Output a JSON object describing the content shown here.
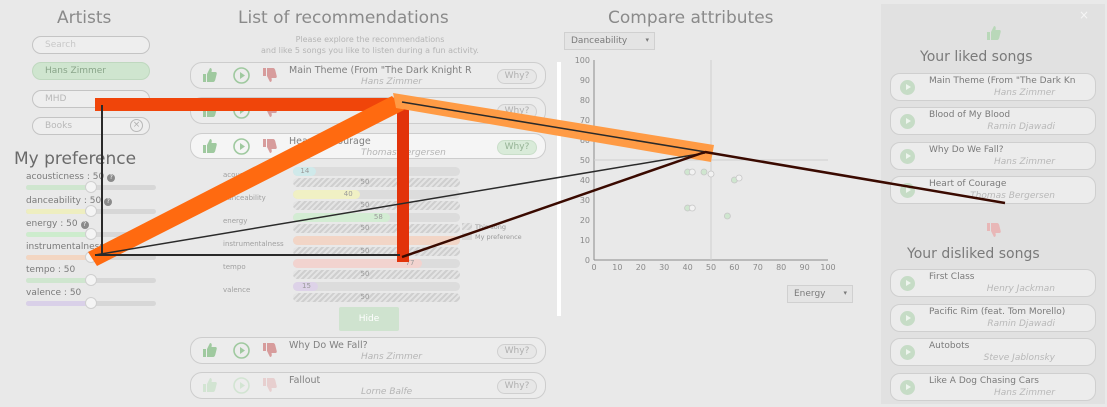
{
  "artists": {
    "title": "Artists",
    "search_placeholder": "Search",
    "selected": [
      "Hans Zimmer",
      "MHD",
      "Books"
    ]
  },
  "preference": {
    "title": "My preference",
    "sliders": [
      {
        "label": "acousticness : 50",
        "value": 50,
        "color": "#cfe6cf"
      },
      {
        "label": "danceability : 50",
        "value": 50,
        "color": "#eeeec0"
      },
      {
        "label": "energy : 50",
        "value": 50,
        "color": "#cdeccd"
      },
      {
        "label": "instrumentalness",
        "value": 50,
        "color": "#f3d6c2"
      },
      {
        "label": "tempo : 50",
        "value": 50,
        "color": "#cfe6cf"
      },
      {
        "label": "valence : 50",
        "value": 50,
        "color": "#d9d0e8"
      }
    ]
  },
  "recommendations": {
    "title": "List of recommendations",
    "subtitle_line1": "Please explore the recommendations",
    "subtitle_line2": "and like 5 songs you like to listen during a fun activity.",
    "why_label": "Why?",
    "hide_label": "Hide",
    "songs": [
      {
        "title": "Main Theme (From \"The Dark Knight R",
        "artist": "Hans Zimmer"
      },
      {
        "title": "",
        "artist": ""
      },
      {
        "title": "Heart of Courage",
        "artist": "Thomas Bergersen"
      },
      {
        "title": "Why Do We Fall?",
        "artist": "Hans Zimmer"
      },
      {
        "title": "Fallout",
        "artist": "Lorne Balfe"
      }
    ],
    "detail": {
      "attributes": [
        {
          "label": "acousticness",
          "song": 14,
          "pref": 50,
          "color": "#cfe9ea"
        },
        {
          "label": "danceability",
          "song": 40,
          "pref": 50,
          "color": "#f0f0c4"
        },
        {
          "label": "energy",
          "song": 58,
          "pref": 50,
          "color": "#d3ecd3"
        },
        {
          "label": "instrumentalness",
          "song": 100,
          "pref": 50,
          "color": "#f2d5c6"
        },
        {
          "label": "tempo",
          "song": 77,
          "pref": 50,
          "color": "#f2d3cf"
        },
        {
          "label": "valence",
          "song": 15,
          "pref": 50,
          "color": "#ddd2e8"
        }
      ],
      "song_values": [
        "14",
        "40",
        "58",
        "",
        "77",
        "15"
      ],
      "pref_value": "50",
      "legend_song": "This song",
      "legend_pref": "My preference"
    }
  },
  "compare": {
    "title": "Compare attributes",
    "y_dropdown": "Danceability",
    "x_dropdown": "Energy"
  },
  "chart_data": {
    "type": "scatter",
    "title": "",
    "xlabel": "",
    "ylabel": "",
    "xlim": [
      0,
      100
    ],
    "ylim": [
      0,
      100
    ],
    "x_ticks": [
      "0",
      "10",
      "20",
      "30",
      "40",
      "50",
      "60",
      "70",
      "80",
      "90",
      "100"
    ],
    "y_ticks": [
      "0",
      "10",
      "20",
      "30",
      "40",
      "50",
      "60",
      "70",
      "80",
      "90",
      "100"
    ],
    "grid": false,
    "crosshair": {
      "x": 50,
      "y": 50
    },
    "points": [
      {
        "x": 40,
        "y": 44
      },
      {
        "x": 42,
        "y": 44
      },
      {
        "x": 47,
        "y": 44
      },
      {
        "x": 50,
        "y": 43
      },
      {
        "x": 60,
        "y": 40
      },
      {
        "x": 62,
        "y": 41
      },
      {
        "x": 40,
        "y": 26
      },
      {
        "x": 42,
        "y": 26
      },
      {
        "x": 57,
        "y": 22
      }
    ]
  },
  "liked": {
    "title": "Your liked songs",
    "songs": [
      {
        "title": "Main Theme (From \"The Dark Kn",
        "artist": "Hans Zimmer"
      },
      {
        "title": "Blood of My Blood",
        "artist": "Ramin Djawadi"
      },
      {
        "title": "Why Do We Fall?",
        "artist": "Hans Zimmer"
      },
      {
        "title": "Heart of Courage",
        "artist": "Thomas Bergersen"
      }
    ]
  },
  "disliked": {
    "title": "Your disliked songs",
    "songs": [
      {
        "title": "First Class",
        "artist": "Henry Jackman"
      },
      {
        "title": "Pacific Rim (feat. Tom Morello)",
        "artist": "Ramin Djawadi"
      },
      {
        "title": "Autobots",
        "artist": "Steve Jablonsky"
      },
      {
        "title": "Like A Dog Chasing Cars",
        "artist": "Hans Zimmer"
      }
    ]
  },
  "close_symbol": "×",
  "colors": {
    "accent_green": "#bcd9bc",
    "overlay_orange": "#ff6a00",
    "overlay_red": "#e8360a",
    "overlay_light_orange": "#ff9a40",
    "overlay_dark": "#3a0a00"
  }
}
